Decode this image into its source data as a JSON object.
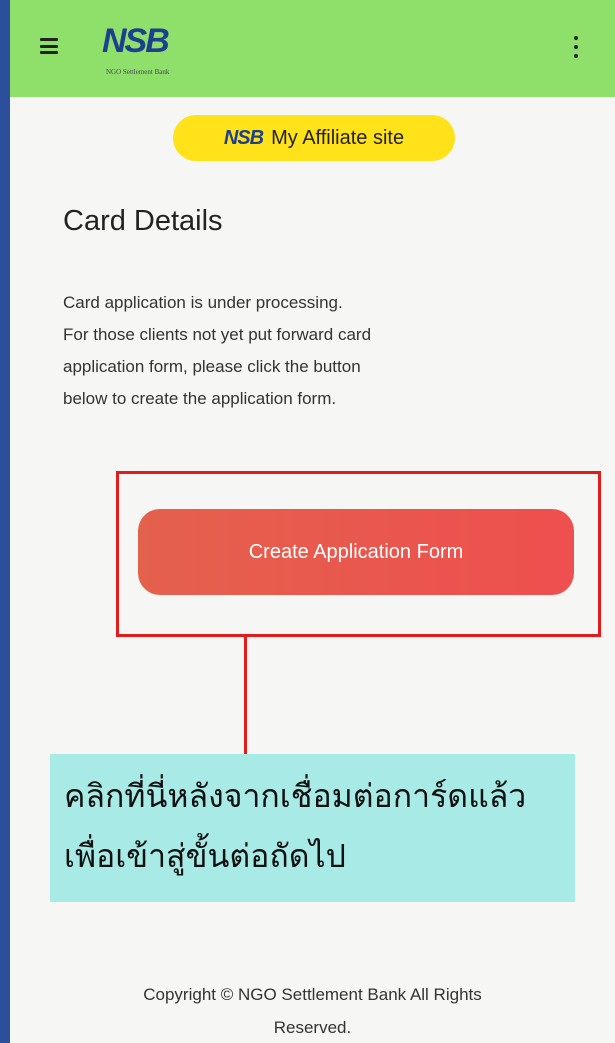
{
  "header": {
    "logo_text": "NSB",
    "logo_subtitle": "NGO Settlement Bank",
    "menu_icon": "hamburger-icon",
    "more_icon": "kebab-menu-icon",
    "bar_color": "#8ee06a"
  },
  "affiliate": {
    "logo_text": "NSB",
    "label": "My Affiliate site",
    "color": "#ffe21a"
  },
  "main": {
    "title": "Card Details",
    "description_lines": [
      "Card application is under processing.",
      "For those clients not yet put forward card",
      "application form, please click the button",
      "below to create the application form."
    ],
    "create_button_label": "Create Application Form"
  },
  "annotation": {
    "box_color": "#e41b1b",
    "callout_lines": [
      "คลิกที่นี่หลังจากเชื่อมต่อการ์ดแล้ว",
      "เพื่อเข้าสู่ขั้นต่อถัดไป"
    ],
    "callout_color": "#a8eae6"
  },
  "footer": {
    "copyright_lines": [
      "Copyright © NGO Settlement Bank All Rights",
      "Reserved."
    ]
  }
}
